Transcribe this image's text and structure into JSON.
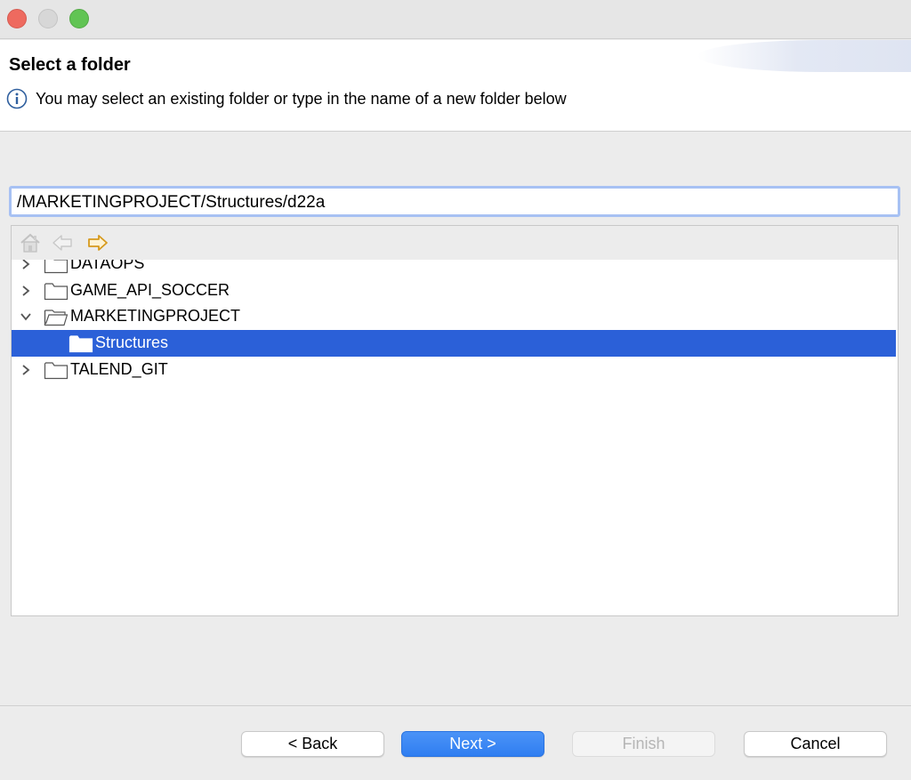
{
  "header": {
    "title": "Select a folder",
    "message": "You may select an existing folder or type in the name of a new folder below"
  },
  "path_input": {
    "value": "/MARKETINGPROJECT/Structures/d22a"
  },
  "toolbar": {
    "icons": [
      "home-icon",
      "back-arrow-icon",
      "forward-arrow-icon"
    ]
  },
  "tree": {
    "items": [
      {
        "label": "DATAOPS",
        "expanded": false,
        "selected": false
      },
      {
        "label": "GAME_API_SOCCER",
        "expanded": false,
        "selected": false
      },
      {
        "label": "MARKETINGPROJECT",
        "expanded": true,
        "selected": false
      },
      {
        "label": "Structures",
        "expanded": false,
        "selected": true
      },
      {
        "label": "TALEND_GIT",
        "expanded": false,
        "selected": false
      }
    ]
  },
  "buttons": {
    "back": "< Back",
    "next": "Next >",
    "finish": "Finish",
    "cancel": "Cancel"
  },
  "colors": {
    "selection": "#2b60d8",
    "primary_button": "#3a86f4",
    "focus_ring": "#a7c1f3"
  }
}
